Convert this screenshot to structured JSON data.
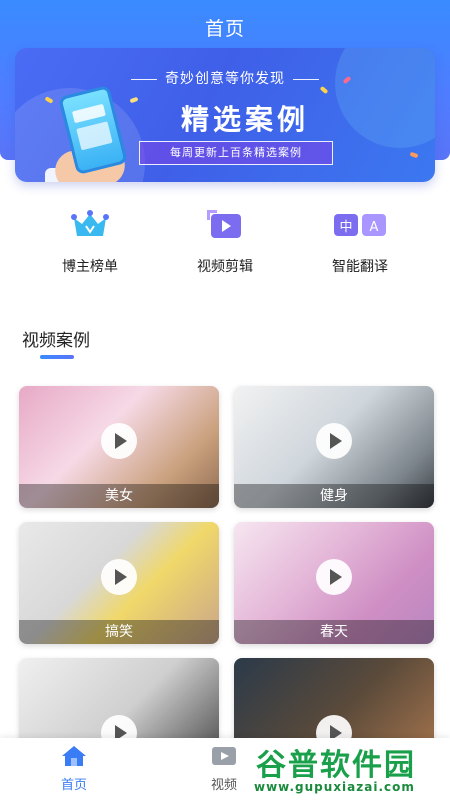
{
  "header": {
    "title": "首页"
  },
  "banner": {
    "subtitle": "奇妙创意等你发现",
    "headline": "精选案例",
    "tagline": "每周更新上百条精选案例"
  },
  "shortcuts": [
    {
      "label": "博主榜单",
      "icon": "crown-icon"
    },
    {
      "label": "视频剪辑",
      "icon": "video-edit-icon"
    },
    {
      "label": "智能翻译",
      "icon": "translate-icon"
    }
  ],
  "section": {
    "title": "视频案例"
  },
  "videos": [
    {
      "caption": "美女",
      "icon": "play-icon"
    },
    {
      "caption": "健身",
      "icon": "play-icon"
    },
    {
      "caption": "搞笑",
      "icon": "play-icon"
    },
    {
      "caption": "春天",
      "icon": "play-icon"
    },
    {
      "caption": "",
      "icon": "play-icon"
    },
    {
      "caption": "",
      "icon": "play-icon"
    }
  ],
  "bottom_nav": [
    {
      "label": "首页",
      "icon": "home-icon",
      "active": true
    },
    {
      "label": "视频",
      "icon": "video-icon",
      "active": false
    }
  ],
  "watermark": {
    "title": "谷普软件园",
    "url": "www.gupuxiazai.com"
  },
  "colors": {
    "primary": "#3a8bff",
    "accent": "#5a74f7",
    "active_nav": "#3a7cf5"
  }
}
